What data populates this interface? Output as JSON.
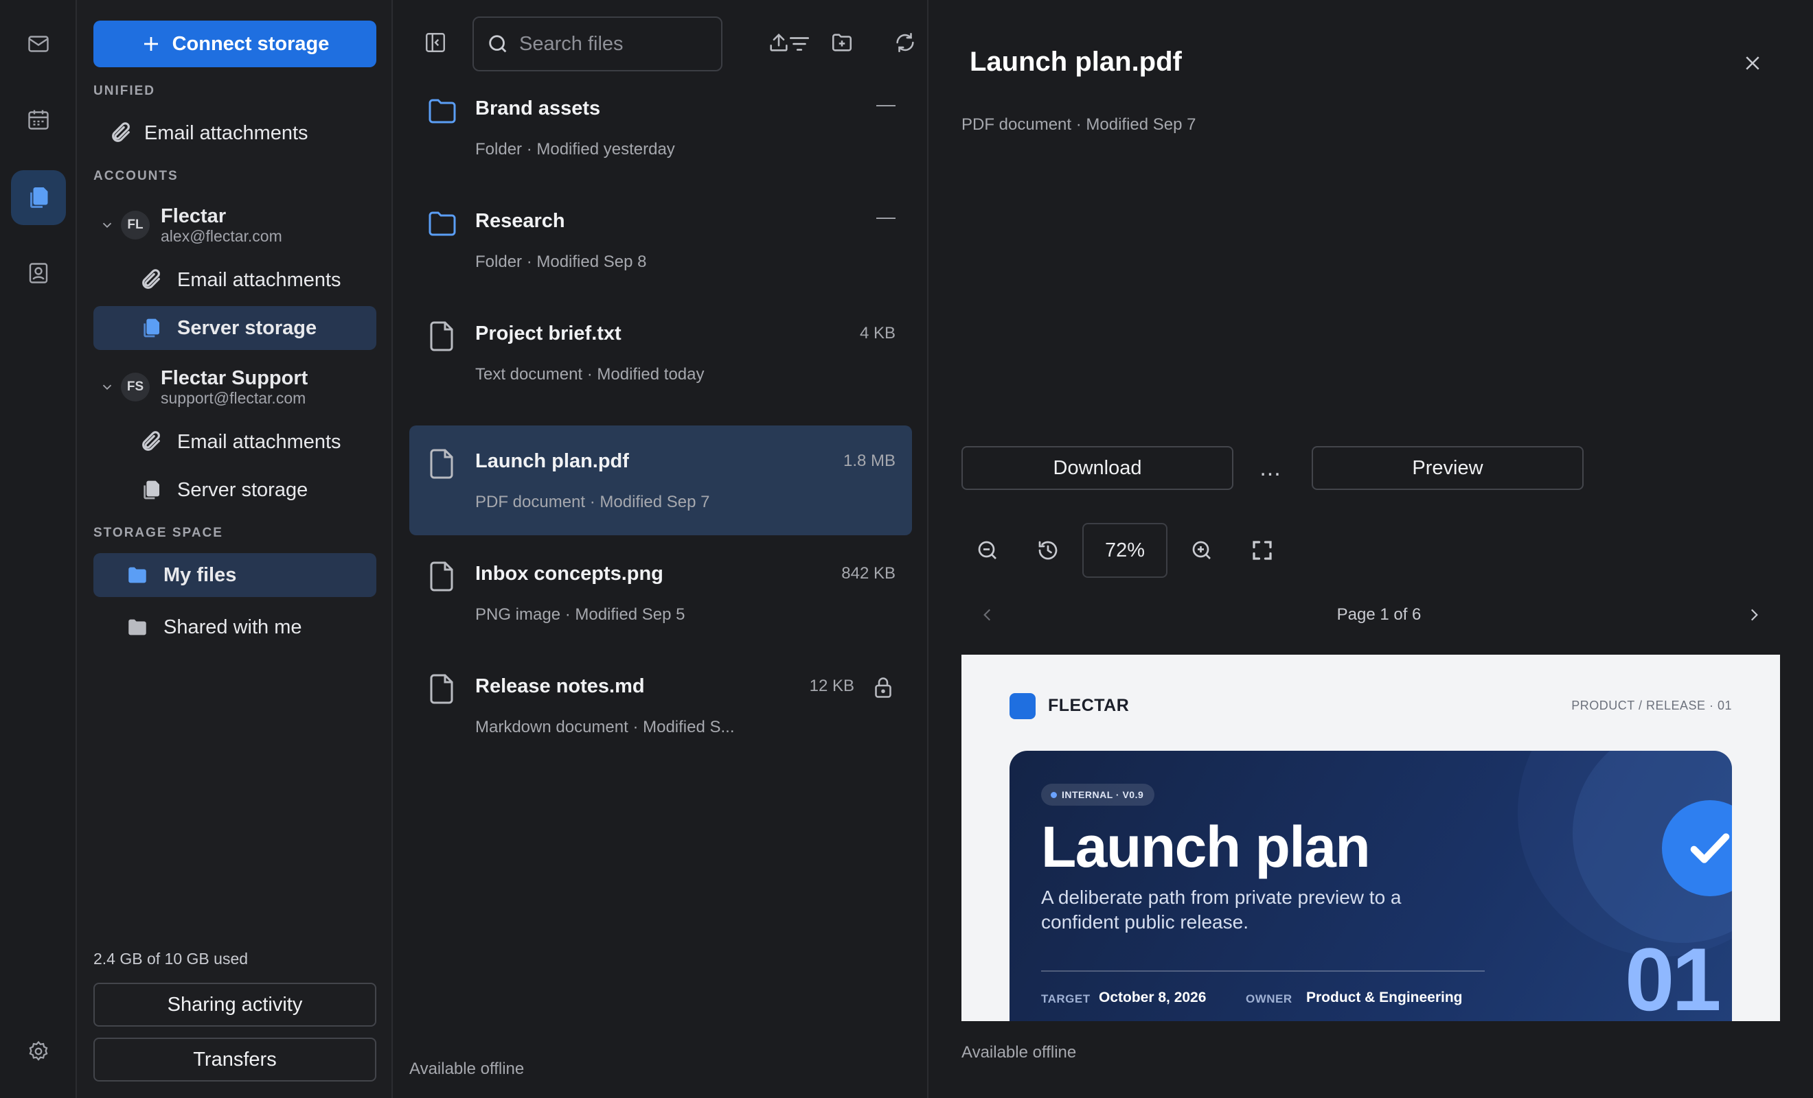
{
  "rail": {
    "items": [
      {
        "icon": "mail-icon"
      },
      {
        "icon": "calendar-icon"
      },
      {
        "icon": "files-icon",
        "active": true
      },
      {
        "icon": "contacts-icon"
      }
    ],
    "settings_icon": "gear-icon"
  },
  "sidebar": {
    "connect_label": "Connect storage",
    "unified_label": "UNIFIED",
    "unified_item": "Email attachments",
    "accounts_label": "ACCOUNTS",
    "accounts": [
      {
        "initials": "FL",
        "name": "Flectar",
        "email": "alex@flectar.com",
        "items": [
          {
            "label": "Email attachments"
          },
          {
            "label": "Server storage",
            "active": true
          }
        ]
      },
      {
        "initials": "FS",
        "name": "Flectar Support",
        "email": "support@flectar.com",
        "items": [
          {
            "label": "Email attachments"
          },
          {
            "label": "Server storage"
          }
        ]
      }
    ],
    "storage_label": "STORAGE SPACE",
    "storage_items": [
      {
        "label": "My files",
        "active": true
      },
      {
        "label": "Shared with me"
      }
    ],
    "usage": "2.4 GB of 10 GB used",
    "sharing_activity": "Sharing activity",
    "transfers": "Transfers"
  },
  "filelist": {
    "search_placeholder": "Search files",
    "files": [
      {
        "name": "Brand assets",
        "meta": "Folder · Modified yesterday",
        "type": "folder",
        "size": "",
        "trail": "—"
      },
      {
        "name": "Research",
        "meta": "Folder · Modified Sep 8",
        "type": "folder",
        "size": "",
        "trail": "—"
      },
      {
        "name": "Project brief.txt",
        "meta": "Text document · Modified today",
        "type": "file",
        "size": "4 KB"
      },
      {
        "name": "Launch plan.pdf",
        "meta": "PDF document · Modified Sep 7",
        "type": "file",
        "size": "1.8 MB",
        "active": true
      },
      {
        "name": "Inbox concepts.png",
        "meta": "PNG image · Modified Sep 5",
        "type": "file",
        "size": "842 KB"
      },
      {
        "name": "Release notes.md",
        "meta": "Markdown document · Modified S...",
        "type": "file",
        "size": "12 KB",
        "locked": true
      }
    ],
    "offline": "Available offline"
  },
  "detail": {
    "title": "Launch plan.pdf",
    "subtitle": "PDF document · Modified Sep 7",
    "download": "Download",
    "more": "...",
    "preview": "Preview",
    "zoom": "72%",
    "page": "Page 1 of 6",
    "offline": "Available offline",
    "doc": {
      "brand": "FLECTAR",
      "crumb": "PRODUCT / RELEASE · 01",
      "badge": "INTERNAL · V0.9",
      "heading": "Launch plan",
      "desc": "A deliberate path from private preview to a confident public release.",
      "target_key": "TARGET",
      "target_val": "October 8, 2026",
      "owner_key": "OWNER",
      "owner_val": "Product & Engineering",
      "number": "01"
    }
  },
  "colors": {
    "accent": "#1f6fe0",
    "selected": "#283a55",
    "folder": "#5b9ef5"
  }
}
